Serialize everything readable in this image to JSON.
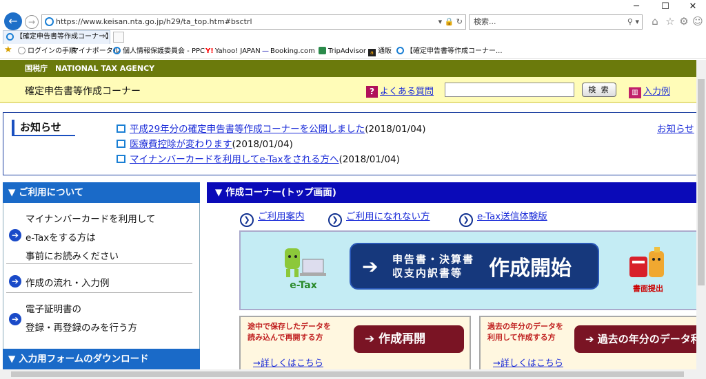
{
  "browser": {
    "url": "https://www.keisan.nta.go.jp/h29/ta_top.htm#bsctrl",
    "search_placeholder": "検索...",
    "tab_title": "【確定申告書等作成コーナー】-...",
    "favorites": [
      "ログインの手順",
      "マイナポータル",
      "個人情報保護委員会 - PPC",
      "Yahoo! JAPAN",
      "Booking.com",
      "TripAdvisor",
      "通販",
      "【確定申告書等作成コーナー..."
    ]
  },
  "header": {
    "agency": "国税庁　NATIONAL TAX AGENCY",
    "title": "確定申告書等作成コーナー",
    "faq": "よくある質問",
    "search_btn": "検 索",
    "example": "入力例"
  },
  "news": {
    "title": "お知らせ",
    "more": "お知らせ",
    "items": [
      {
        "link": "平成29年分の確定申告書等作成コーナーを公開しました",
        "date": "(2018/01/04)"
      },
      {
        "link": "医療費控除が変わります",
        "date": "(2018/01/04)"
      },
      {
        "link": "マイナンバーカードを利用してe-Taxをされる方へ",
        "date": "(2018/01/04)"
      }
    ]
  },
  "sidebar": {
    "section1": "▼ ご利用について",
    "item1": [
      "マイナンバーカードを利用して",
      "e-Taxをする方は",
      "事前にお読みください"
    ],
    "item2": "作成の流れ・入力例",
    "item3": [
      "電子証明書の",
      "登録・再登録のみを行う方"
    ],
    "section2": "▼ 入力用フォームのダウンロード"
  },
  "main": {
    "heading": "▼ 作成コーナー(トップ画面)",
    "links": [
      "ご利用案内",
      "ご利用になれない方",
      "e-Tax送信体験版"
    ],
    "etax_label": "e-Tax",
    "start_line1": "申告書・決算書",
    "start_line2": "収支内訳書等",
    "start_big": "作成開始",
    "paper_label": "書面提出",
    "card1": {
      "text1": "途中で保存したデータを",
      "text2": "読み込んで再開する方",
      "button": "作成再開",
      "link": "→詳しくはこちら"
    },
    "card2": {
      "text1": "過去の年分のデータを",
      "text2": "利用して作成する方",
      "button": "過去の年分のデータ利用",
      "link": "→詳しくはこちら"
    }
  }
}
